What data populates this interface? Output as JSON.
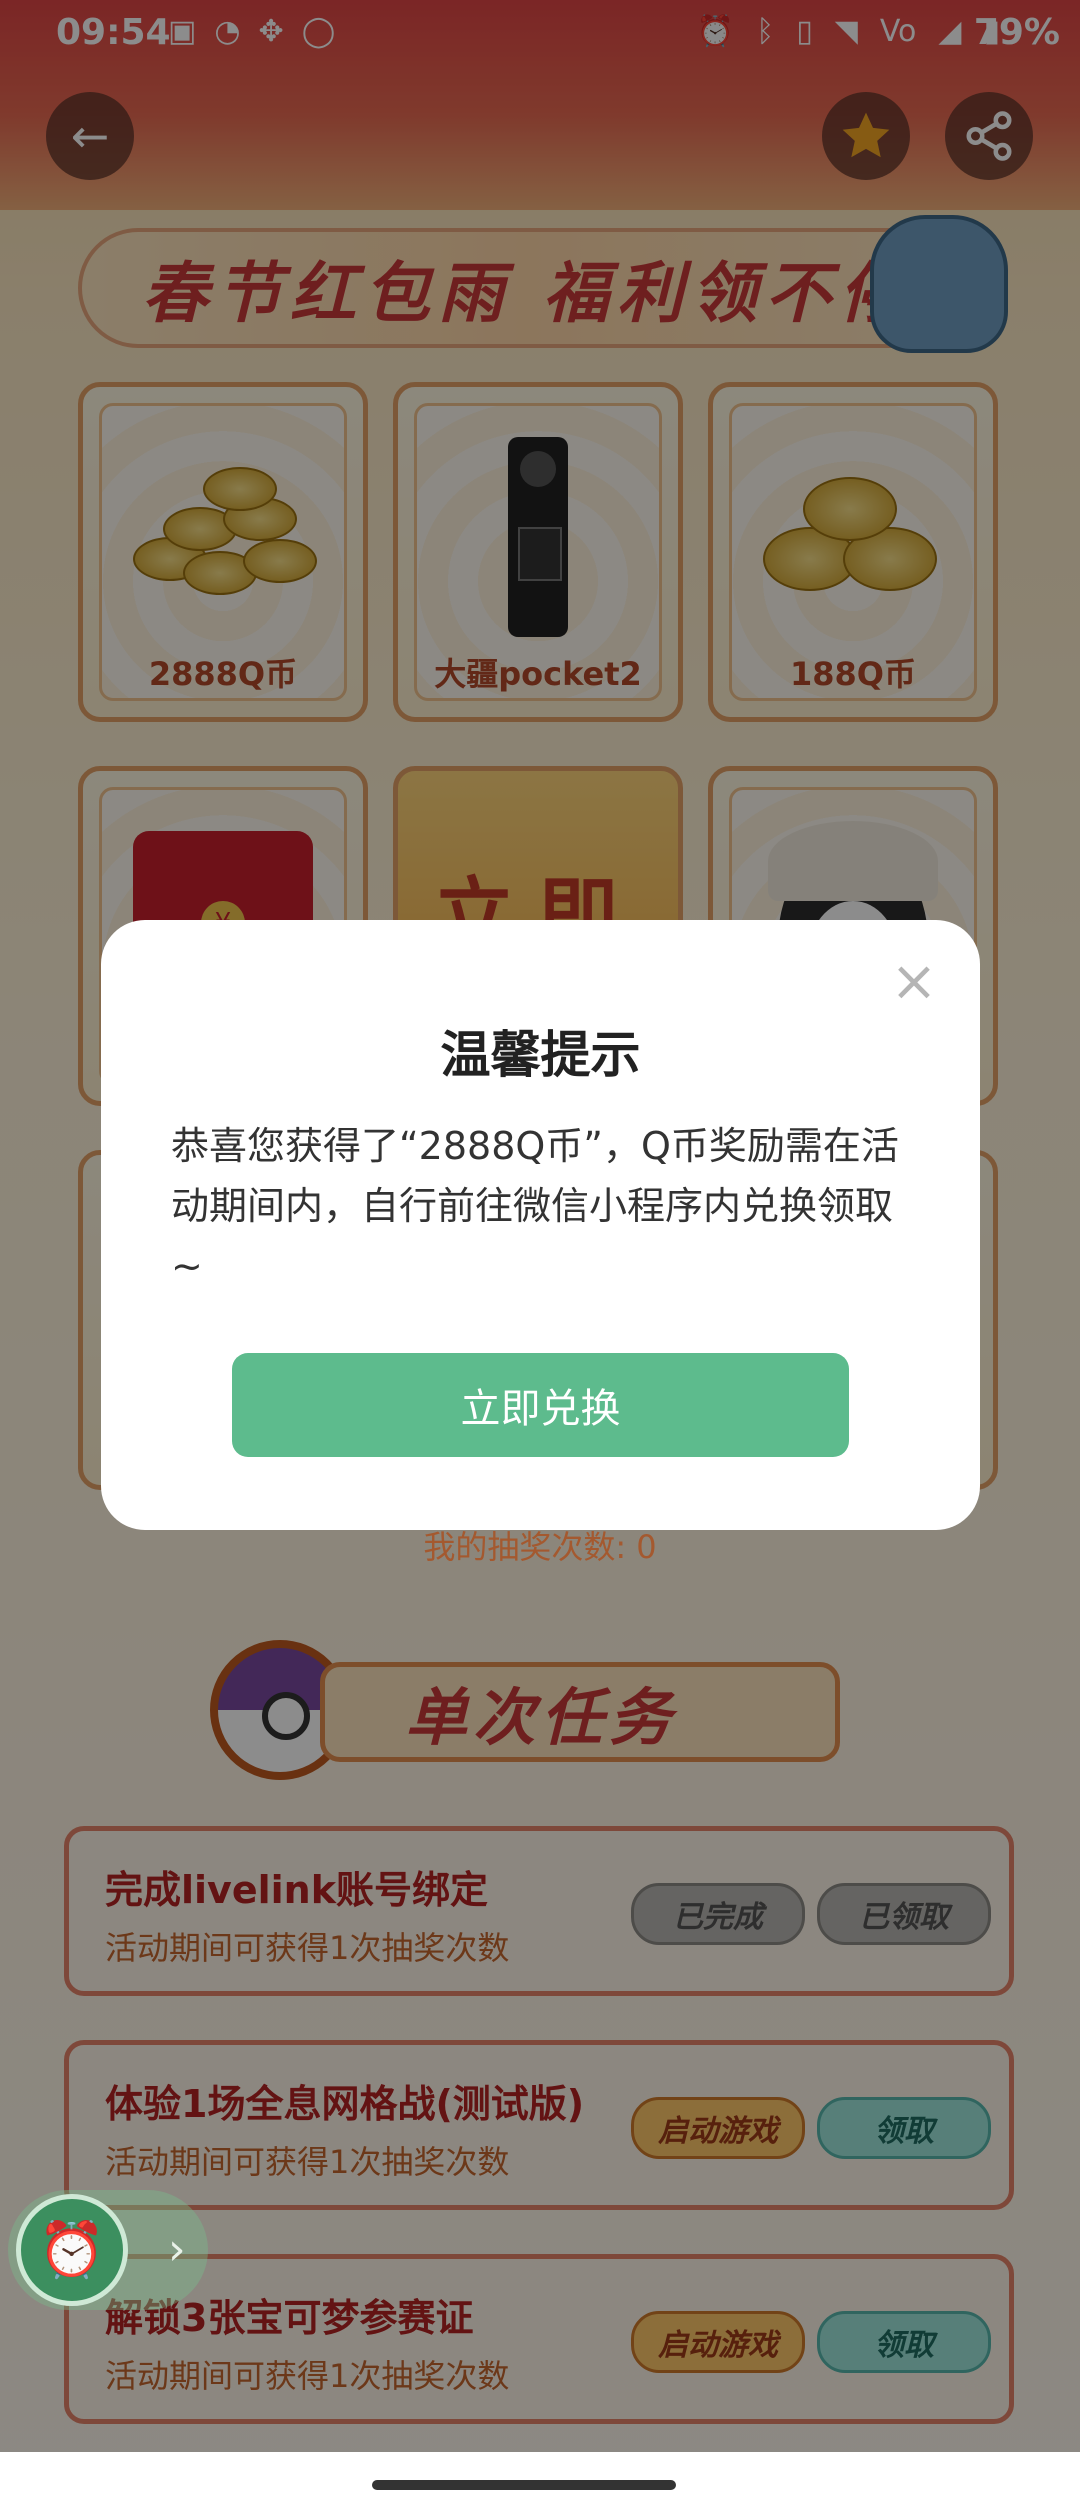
{
  "status_bar": {
    "time": "09:54",
    "left_icons": [
      "game-box-icon",
      "qq-icon",
      "gamepad-icon",
      "circle-icon"
    ],
    "right_icons": [
      "alarm-icon",
      "bluetooth-icon",
      "vibrate-icon",
      "wifi-icon",
      "volte-nr-icon",
      "signal-icon",
      "battery-icon"
    ],
    "battery": "79%"
  },
  "header": {
    "banner_text": "春节红包雨 福利领不停",
    "back_icon": "arrow-left-icon",
    "favorite_icon": "star-icon",
    "share_icon": "share-icon"
  },
  "prizes": [
    {
      "label": "2888Q币"
    },
    {
      "label": "大疆pocket2"
    },
    {
      "label": "188Q币"
    }
  ],
  "lottery_button_text": "立即",
  "draw_count_text": "我的抽奖次数: 0",
  "single_task": {
    "title": "单次任务",
    "tasks": [
      {
        "title": "完成livelink账号绑定",
        "sub": "活动期间可获得1次抽奖次数",
        "btn1": "已完成",
        "btn2": "已领取"
      },
      {
        "title": "体验1场全息网格战(测试版)",
        "sub": "活动期间可获得1次抽奖次数",
        "btn1": "启动游戏",
        "btn2": "领取"
      },
      {
        "title": "解锁3张宝可梦参赛证",
        "sub": "活动期间可获得1次抽奖次数",
        "btn1": "启动游戏",
        "btn2": "领取"
      }
    ]
  },
  "dialog": {
    "title": "温馨提示",
    "message": "恭喜您获得了“2888Q币”，Q币奖励需在活动期间内，自行前往微信小程序内兑换领取~",
    "button": "立即兑换",
    "close_icon": "close-icon"
  },
  "colors": {
    "dialog_button": "#5dbb8d",
    "task_title": "#b52323",
    "task_sub": "#c5662f"
  }
}
